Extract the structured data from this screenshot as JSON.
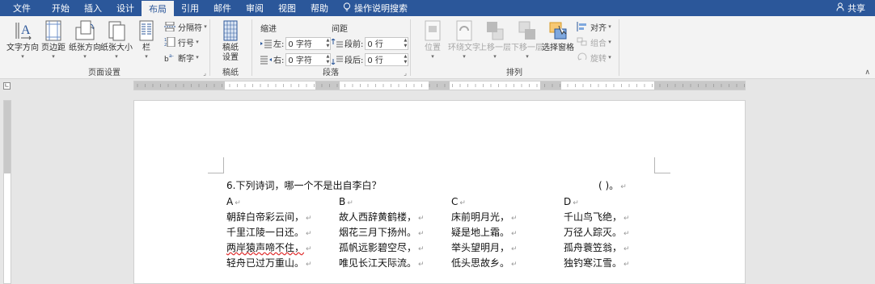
{
  "tabs": [
    "文件",
    "开始",
    "插入",
    "设计",
    "布局",
    "引用",
    "邮件",
    "审阅",
    "视图",
    "帮助",
    "操作说明搜索"
  ],
  "share": "共享",
  "ribbon": {
    "page_setup": {
      "label": "页面设置",
      "text_direction": "文字方向",
      "margins": "页边距",
      "orientation": "纸张方向",
      "size": "纸张大小",
      "columns": "栏",
      "breaks": "分隔符",
      "line_numbers": "行号",
      "hyphenation": "断字"
    },
    "manuscript": {
      "label": "稿纸",
      "settings": "稿纸\n设置"
    },
    "paragraph": {
      "label": "段落",
      "indent": "缩进",
      "spacing": "间距",
      "left": "左:",
      "right": "右:",
      "before": "段前:",
      "after": "段后:",
      "left_value": "0 字符",
      "right_value": "0 字符",
      "before_value": "0 行",
      "after_value": "0 行"
    },
    "arrange": {
      "label": "排列",
      "position": "位置",
      "wrap_text": "环绕文字",
      "bring_forward": "上移一层",
      "send_backward": "下移一层",
      "selection_pane": "选择窗格",
      "align": "对齐",
      "group": "组合",
      "rotate": "旋转"
    }
  },
  "document": {
    "question": "6.下列诗词，哪一个不是出自李白？",
    "answer_paren": "(          )。",
    "options": [
      {
        "letter": "A",
        "lines": [
          "朝辞白帝彩云间，",
          "千里江陵一日还。",
          "两岸猿声啼不住，",
          "轻舟已过万重山。"
        ]
      },
      {
        "letter": "B",
        "lines": [
          "故人西辞黄鹤楼，",
          "烟花三月下扬州。",
          "孤帆远影碧空尽，",
          "唯见长江天际流。"
        ]
      },
      {
        "letter": "C",
        "lines": [
          "床前明月光，",
          "疑是地上霜。",
          "举头望明月，",
          "低头思故乡。"
        ]
      },
      {
        "letter": "D",
        "lines": [
          "千山鸟飞绝，",
          "万径人踪灭。",
          "孤舟蓑笠翁，",
          "独钓寒江雪。"
        ]
      }
    ]
  }
}
